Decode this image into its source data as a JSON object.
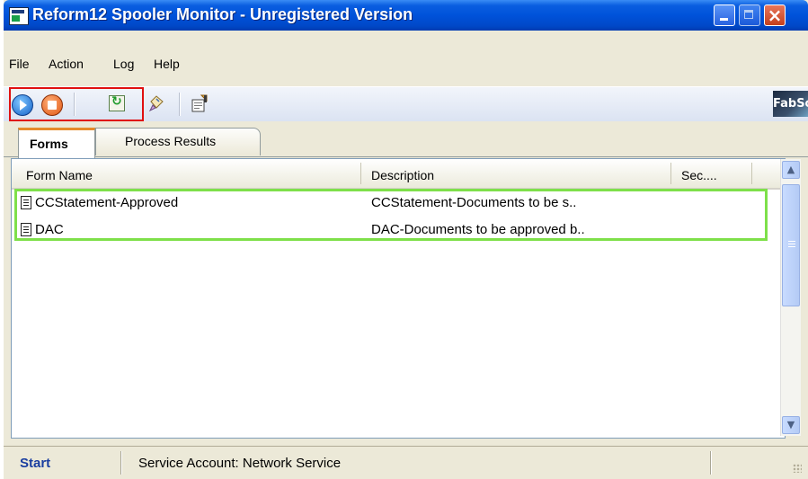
{
  "window": {
    "title": "Reform12 Spooler Monitor - Unregistered Version"
  },
  "menu": {
    "items": [
      "File",
      "Action",
      "Log",
      "Help"
    ]
  },
  "toolbar": {
    "brand": "FabSoft"
  },
  "tabs": [
    {
      "label": "Forms",
      "active": true
    },
    {
      "label": "Process Results",
      "active": false
    }
  ],
  "list": {
    "columns": [
      "Form Name",
      "Description",
      "Sec...."
    ],
    "rows": [
      {
        "name": "CCStatement-Approved",
        "description": "CCStatement-Documents to be s.."
      },
      {
        "name": "DAC",
        "description": "DAC-Documents to be approved b.."
      }
    ]
  },
  "status": {
    "start": "Start",
    "account": "Service Account: Network Service"
  },
  "colors": {
    "title_blue": "#0052da",
    "highlight_red": "#e01010",
    "highlight_green": "#7ee04a",
    "tab_accent": "#e68b2c"
  }
}
